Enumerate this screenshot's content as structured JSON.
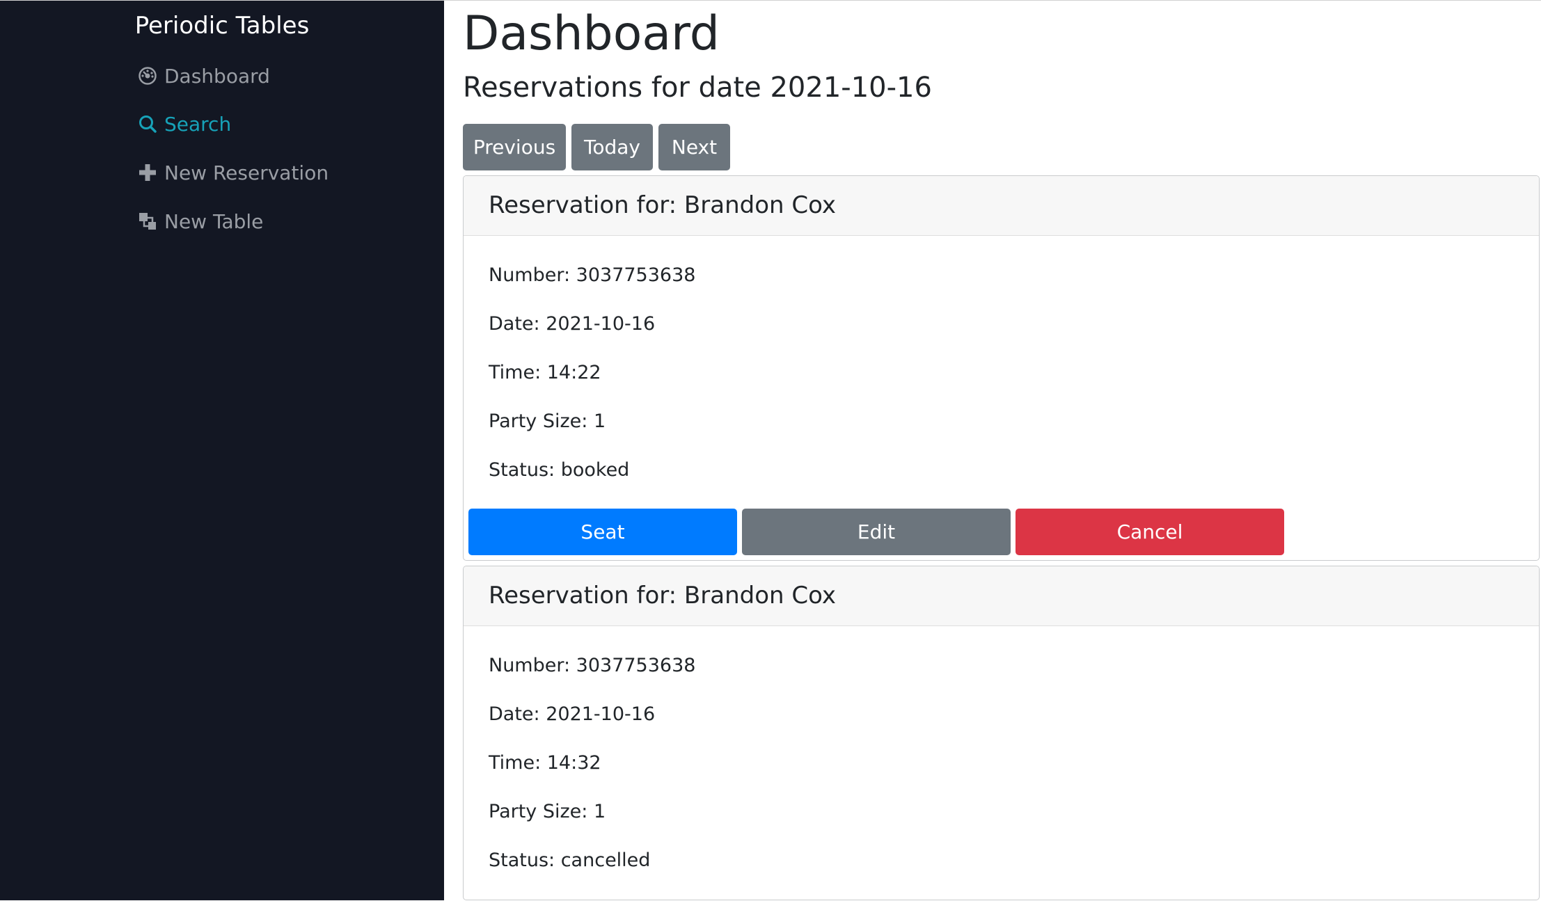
{
  "sidebar": {
    "brand": "Periodic Tables",
    "items": [
      {
        "label": "Dashboard",
        "icon": "dashboard-icon",
        "active": false
      },
      {
        "label": "Search",
        "icon": "search-icon",
        "active": true
      },
      {
        "label": "New Reservation",
        "icon": "plus-icon",
        "active": false
      },
      {
        "label": "New Table",
        "icon": "table-icon",
        "active": false
      }
    ]
  },
  "main": {
    "title": "Dashboard",
    "subtitle": "Reservations for date 2021-10-16",
    "nav_buttons": {
      "previous": "Previous",
      "today": "Today",
      "next": "Next"
    },
    "reservations": [
      {
        "header": "Reservation for: Brandon Cox",
        "number": "Number: 3037753638",
        "date": "Date: 2021-10-16",
        "time": "Time: 14:22",
        "party_size": "Party Size: 1",
        "status": "Status: booked",
        "actions": {
          "seat": "Seat",
          "edit": "Edit",
          "cancel": "Cancel"
        }
      },
      {
        "header": "Reservation for: Brandon Cox",
        "number": "Number: 3037753638",
        "date": "Date: 2021-10-16",
        "time": "Time: 14:32",
        "party_size": "Party Size: 1",
        "status": "Status: cancelled"
      }
    ]
  },
  "colors": {
    "sidebar_bg": "#131723",
    "active_link": "#17a2b8",
    "inactive_link": "#9a9ea5",
    "secondary": "#6c757d",
    "primary": "#007bff",
    "danger": "#dc3545"
  }
}
